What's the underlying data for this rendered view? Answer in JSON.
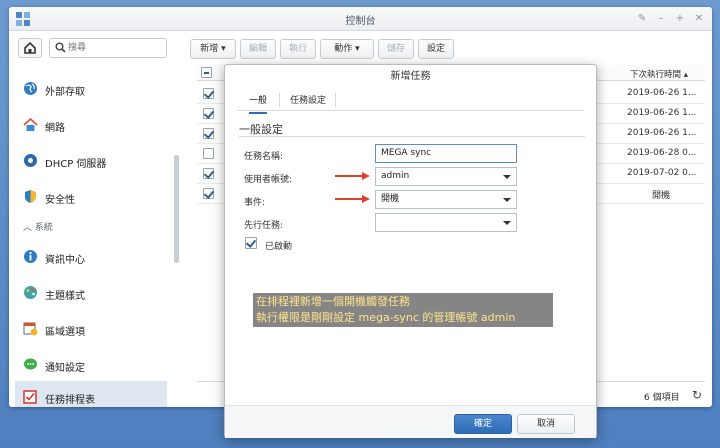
{
  "window": {
    "title": "控制台"
  },
  "sidebar": {
    "search_placeholder": "搜尋",
    "section_system": "系統",
    "items": [
      {
        "label": "外部存取",
        "icon": "globe-icon"
      },
      {
        "label": "網路",
        "icon": "house-network-icon"
      },
      {
        "label": "DHCP 伺服器",
        "icon": "dhcp-icon"
      },
      {
        "label": "安全性",
        "icon": "shield-icon"
      },
      {
        "label": "資訊中心",
        "icon": "info-icon"
      },
      {
        "label": "主題樣式",
        "icon": "palette-icon"
      },
      {
        "label": "區域選項",
        "icon": "calendar-clock-icon"
      },
      {
        "label": "通知設定",
        "icon": "chat-bubble-icon"
      },
      {
        "label": "任務排程表",
        "icon": "task-scheduler-icon",
        "active": true
      }
    ]
  },
  "toolbar": {
    "create": "新增",
    "edit": "編輯",
    "run": "執行",
    "action": "動作",
    "save": "儲存",
    "settings": "設定"
  },
  "grid": {
    "next_run_header": "下次執行時間",
    "rows": [
      {
        "checked": true,
        "next_run": "2019-06-26 1..."
      },
      {
        "checked": true,
        "next_run": "2019-06-26 1..."
      },
      {
        "checked": true,
        "next_run": "2019-06-26 1..."
      },
      {
        "checked": false,
        "next_run": "2019-06-28 0..."
      },
      {
        "checked": true,
        "next_run": "2019-07-02 0..."
      },
      {
        "checked": true,
        "next_run": "開機"
      }
    ],
    "item_count": "6 個項目"
  },
  "dialog": {
    "title": "新增任務",
    "tabs": [
      "一般",
      "任務設定"
    ],
    "section_title": "一般設定",
    "labels": {
      "task_name": "任務名稱:",
      "user": "使用者帳號:",
      "event": "事件:",
      "pre_task": "先行任務:",
      "enabled": "已啟動"
    },
    "values": {
      "task_name": "MEGA sync",
      "user": "admin",
      "event": "開機",
      "pre_task": ""
    },
    "enabled_checked": true,
    "ok": "確定",
    "cancel": "取消"
  },
  "caption": {
    "line1": "在排程裡新增一個開機觸發任務",
    "line2": "執行權限是剛剛設定 mega-sync 的管理帳號 admin"
  },
  "colors": {
    "accent": "#2f6db7",
    "arrow": "#e0402a",
    "caption_text": "#ffe58a"
  }
}
